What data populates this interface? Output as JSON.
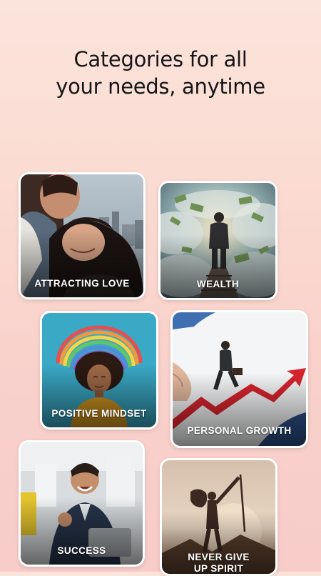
{
  "headline": {
    "line1": "Categories for all",
    "line2": "your needs, anytime"
  },
  "categories": [
    {
      "label": "ATTRACTING LOVE"
    },
    {
      "label": "WEALTH"
    },
    {
      "label": "POSITIVE MINDSET"
    },
    {
      "label": "PERSONAL GROWTH"
    },
    {
      "label": "SUCCESS"
    },
    {
      "label_line1": "NEVER GIVE",
      "label_line2": "UP SPIRIT"
    }
  ]
}
